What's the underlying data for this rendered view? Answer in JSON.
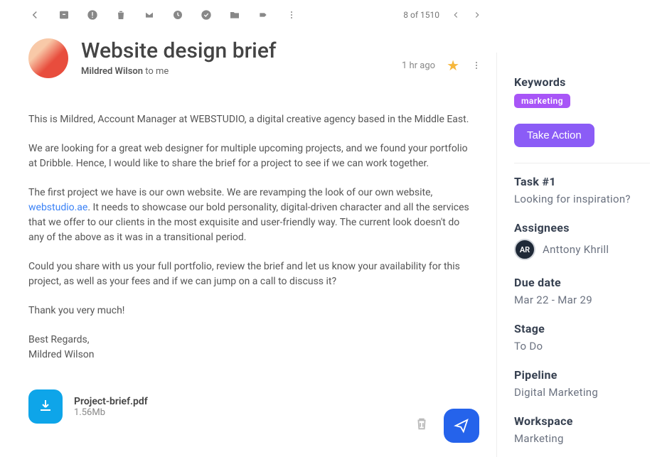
{
  "toolbar": {
    "pageInfo": "8 of 1510"
  },
  "email": {
    "subject": "Website design brief",
    "fromName": "Mildred Wilson",
    "toPrefix": " to ",
    "toName": "me",
    "time": "1 hr ago",
    "body": {
      "p1": "This is Mildred, Account Manager at WEBSTUDIO, a digital creative agency based in the Middle East.",
      "p2": "We are looking for a great web designer for multiple upcoming projects, and we found your portfolio at Dribble. Hence, I would like to share the brief for a project to see if we can work together.",
      "p3a": "The first project we have is our own website. We are revamping the look of our own website, ",
      "p3link": "webstudio.ae",
      "p3b": ". It needs to showcase our bold personality, digital-driven character and all the services that we offer to our clients in the most exquisite and user-friendly way. The current look doesn't do any of the above as it was in a transitional period.",
      "p4": "Could you share with us your full portfolio, review the brief and let us know your availability for this project, as well as your fees and if we can jump on a call to discuss it?",
      "p5": "Thank you very much!",
      "closing1": "Best Regards,",
      "closing2": "Mildred Wilson"
    },
    "attachment": {
      "name": "Project-brief.pdf",
      "size": "1.56Mb"
    }
  },
  "sidebar": {
    "keywords": {
      "title": "Keywords",
      "tag": "marketing"
    },
    "action": "Take Action",
    "task": {
      "title": "Task #1",
      "value": "Looking for inspiration?"
    },
    "assignees": {
      "title": "Assignees",
      "initials": "AR",
      "name": "Anttony Khrill"
    },
    "dueDate": {
      "title": "Due date",
      "value": "Mar 22 - Mar 29"
    },
    "stage": {
      "title": "Stage",
      "value": "To Do"
    },
    "pipeline": {
      "title": "Pipeline",
      "value": "Digital Marketing"
    },
    "workspace": {
      "title": "Workspace",
      "value": "Marketing"
    }
  }
}
